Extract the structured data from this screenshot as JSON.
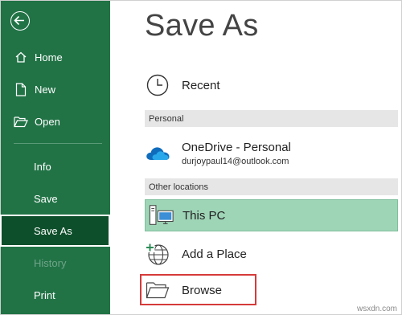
{
  "sidebar": {
    "items": [
      {
        "label": "Home"
      },
      {
        "label": "New"
      },
      {
        "label": "Open"
      },
      {
        "label": "Info"
      },
      {
        "label": "Save"
      },
      {
        "label": "Save As"
      },
      {
        "label": "History"
      },
      {
        "label": "Print"
      }
    ],
    "selected": "Save As",
    "disabled": [
      "History"
    ]
  },
  "main": {
    "title": "Save As",
    "recent_label": "Recent",
    "personal_header": "Personal",
    "onedrive": {
      "name": "OneDrive - Personal",
      "account": "durjoypaul14@outlook.com"
    },
    "other_header": "Other locations",
    "this_pc_label": "This PC",
    "add_place_label": "Add a Place",
    "browse_label": "Browse"
  },
  "watermark": "wsxdn.com",
  "colors": {
    "sidebar_bg": "#217346",
    "selected_bg": "#0e4f2b",
    "this_pc_bg": "#9fd5b7",
    "highlight_border": "#d63a3a",
    "onedrive_blue": "#0f6cbd"
  },
  "icons": [
    "back-arrow-icon",
    "home-icon",
    "new-document-icon",
    "open-folder-icon",
    "clock-icon",
    "onedrive-cloud-icon",
    "computer-icon",
    "globe-add-icon",
    "folder-icon"
  ]
}
